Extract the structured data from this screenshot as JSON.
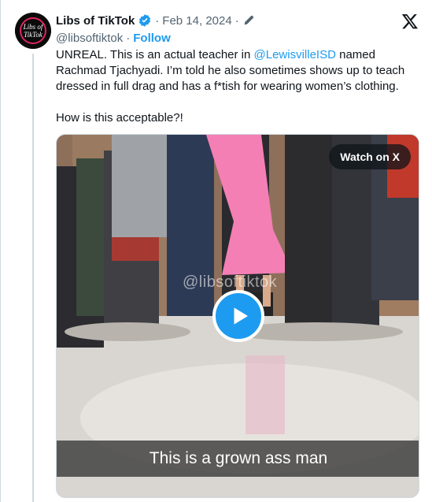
{
  "tweet": {
    "author_name": "Libs of TikTok",
    "separator_1": "·",
    "date": "Feb 14, 2024",
    "separator_2": "·",
    "handle": "@libsoftiktok",
    "separator_3": "·",
    "follow_label": "Follow",
    "avatar_text_line1": "Libs of",
    "avatar_text_line2": "TikTok",
    "text_line1_pre": "UNREAL. This is an actual teacher in ",
    "text_line1_mention": "@LewisvilleISD",
    "text_line1_post": " named",
    "text_line2": "Rachmad Tjachyadi. I’m told he also sometimes shows up to teach",
    "text_line3": "dressed in full drag and has a f*tish for wearing women’s clothing.",
    "text_line4": "How is this acceptable?!"
  },
  "media": {
    "watch_label": "Watch on X",
    "watermark": "@libsoftiktok",
    "caption": "This is a grown ass man"
  },
  "icons": {
    "verified": "verified-badge-icon",
    "edit": "edit-pencil-icon",
    "platform": "x-logo-icon",
    "play": "play-icon"
  },
  "colors": {
    "accent": "#1d9bf0",
    "text": "#0f1419",
    "muted": "#536471"
  }
}
